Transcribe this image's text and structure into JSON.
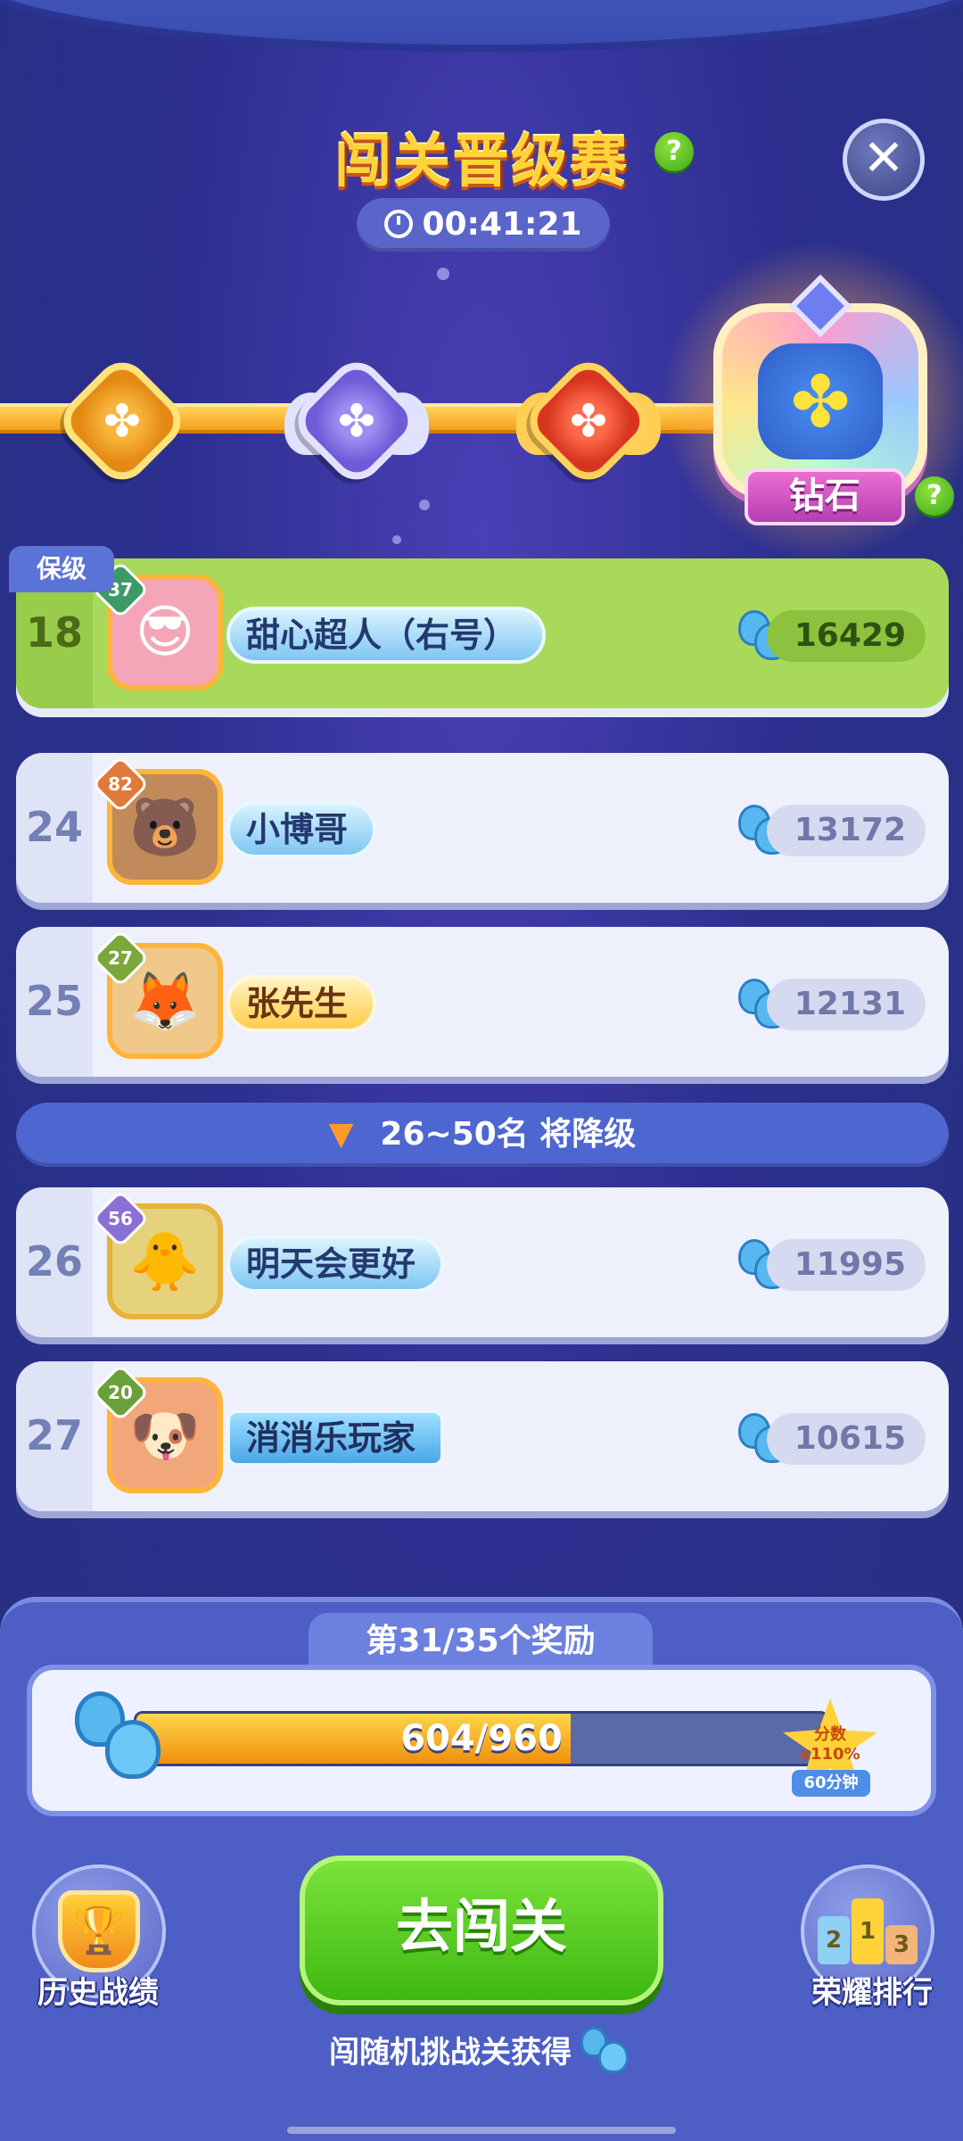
{
  "header": {
    "title": "闯关晋级赛",
    "timer": "00:41:21",
    "help_glyph": "?",
    "close_glyph": "✕"
  },
  "tiers": {
    "current_label": "钻石",
    "icons": [
      "gold-clover-badge",
      "silver-clover-badge",
      "red-clover-badge",
      "diamond-clover-badge"
    ]
  },
  "leaderboard": {
    "keep_tag": "保级",
    "rows": [
      {
        "rank": "18",
        "level": "37",
        "name": "甜心超人（右号）",
        "score": "16429",
        "highlight": true
      },
      {
        "rank": "24",
        "level": "82",
        "name": "小博哥",
        "score": "13172",
        "highlight": false
      },
      {
        "rank": "25",
        "level": "27",
        "name": "张先生",
        "score": "12131",
        "highlight": false
      },
      {
        "rank": "26",
        "level": "56",
        "name": "明天会更好",
        "score": "11995",
        "highlight": false
      },
      {
        "rank": "27",
        "level": "20",
        "name": "消消乐玩家",
        "score": "10615",
        "highlight": false
      }
    ],
    "demote_text": "26~50名  将降级",
    "demote_arrow": "▼"
  },
  "reward": {
    "title": "第31/35个奖励",
    "progress_text": "604/960",
    "progress_value": 604,
    "progress_max": 960,
    "bonus_line1": "分数",
    "bonus_line2": "x110%",
    "bonus_time": "60分钟"
  },
  "actions": {
    "history_label": "历史战绩",
    "go_label": "去闯关",
    "ranking_label": "荣耀排行",
    "hint": "闯随机挑战关获得",
    "podium": [
      "2",
      "1",
      "3"
    ]
  },
  "colors": {
    "accent_green": "#3fb812",
    "highlight_row": "#a9d95a",
    "progress_fill": "#f08f0d"
  }
}
